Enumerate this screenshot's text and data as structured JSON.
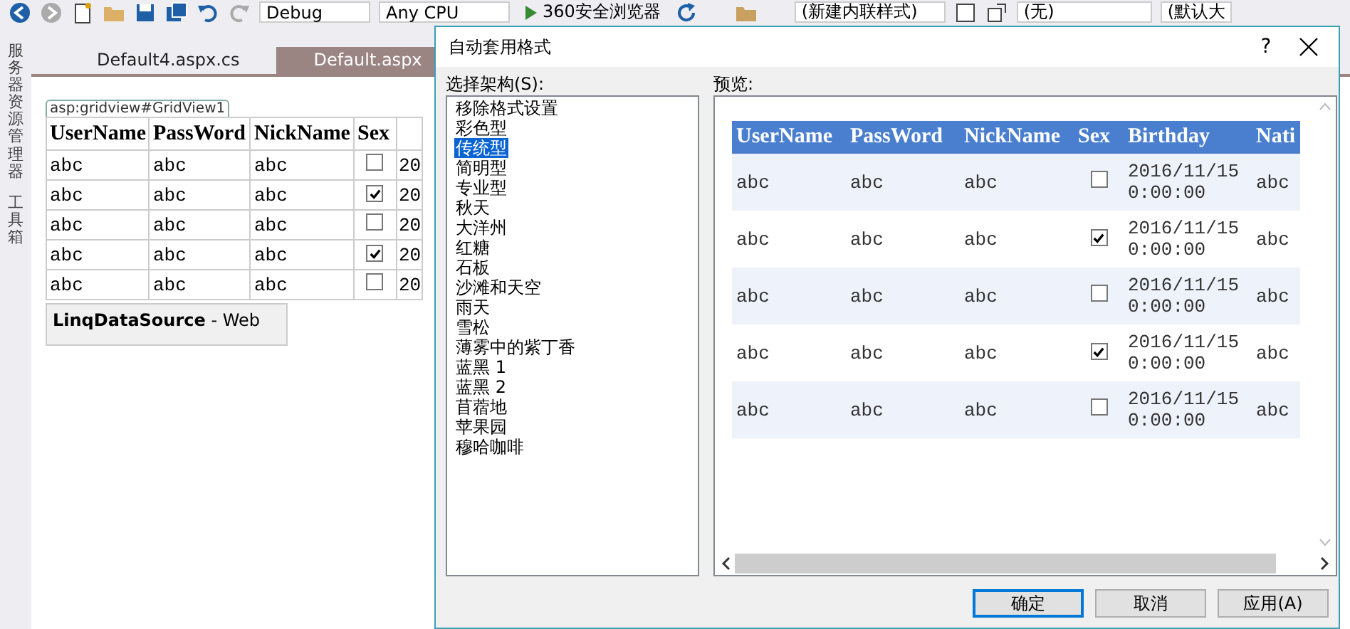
{
  "toolbar": {
    "configuration": "Debug",
    "platform": "Any CPU",
    "browser": "360安全浏览器",
    "style": "(新建内联样式)",
    "target": "(无)",
    "size": "(默认大"
  },
  "side_panels": [
    "服务器资源管理器",
    "工具箱"
  ],
  "tabs": [
    {
      "label": "Default4.aspx.cs",
      "selected": false
    },
    {
      "label": "Default.aspx",
      "selected": true
    }
  ],
  "designer": {
    "control_tag": "asp:gridview#GridView1",
    "grid": {
      "columns": [
        "UserName",
        "PassWord",
        "NickName",
        "Sex"
      ],
      "rows": [
        {
          "cells": [
            "abc",
            "abc",
            "abc"
          ],
          "checked": false,
          "column_5": "20"
        },
        {
          "cells": [
            "abc",
            "abc",
            "abc"
          ],
          "checked": true,
          "column_5": "20"
        },
        {
          "cells": [
            "abc",
            "abc",
            "abc"
          ],
          "checked": false,
          "column_5": "20"
        },
        {
          "cells": [
            "abc",
            "abc",
            "abc"
          ],
          "checked": true,
          "column_5": "20"
        },
        {
          "cells": [
            "abc",
            "abc",
            "abc"
          ],
          "checked": false,
          "column_5": "20"
        }
      ]
    },
    "data_source": "**LinqDataSource** - Web"
  },
  "dialog": {
    "title": "自动套用格式",
    "help": "?",
    "schemes_label": "选择架构(S):",
    "schemes": [
      {
        "label": "移除格式设置",
        "selected": false
      },
      {
        "label": "彩色型",
        "selected": false
      },
      {
        "label": "传统型",
        "selected": true
      },
      {
        "label": "简明型",
        "selected": false
      },
      {
        "label": "专业型",
        "selected": false
      },
      {
        "label": "秋天",
        "selected": false
      },
      {
        "label": "大洋州",
        "selected": false
      },
      {
        "label": "红糖",
        "selected": false
      },
      {
        "label": "石板",
        "selected": false
      },
      {
        "label": "沙滩和天空",
        "selected": false
      },
      {
        "label": "雨天",
        "selected": false
      },
      {
        "label": "雪松",
        "selected": false
      },
      {
        "label": "薄雾中的紫丁香",
        "selected": false
      },
      {
        "label": "蓝黑 1",
        "selected": false
      },
      {
        "label": "蓝黑 2",
        "selected": false
      },
      {
        "label": "苜蓿地",
        "selected": false
      },
      {
        "label": "苹果园",
        "selected": false
      },
      {
        "label": "穆哈咖啡",
        "selected": false
      }
    ],
    "preview_label": "预览:",
    "preview": {
      "columns": [
        "UserName",
        "PassWord",
        "NickName",
        "Sex",
        "Birthday",
        "Nati"
      ],
      "rows": [
        {
          "cells": [
            "abc",
            "abc",
            "abc"
          ],
          "checked": false,
          "birthday": "2016/11/15 0:00:00",
          "column_6": "abc"
        },
        {
          "cells": [
            "abc",
            "abc",
            "abc"
          ],
          "checked": true,
          "birthday": "2016/11/15 0:00:00",
          "column_6": "abc"
        },
        {
          "cells": [
            "abc",
            "abc",
            "abc"
          ],
          "checked": false,
          "birthday": "2016/11/15 0:00:00",
          "column_6": "abc"
        },
        {
          "cells": [
            "abc",
            "abc",
            "abc"
          ],
          "checked": true,
          "birthday": "2016/11/15 0:00:00",
          "column_6": "abc"
        },
        {
          "cells": [
            "abc",
            "abc",
            "abc"
          ],
          "checked": false,
          "birthday": "2016/11/15 0:00:00",
          "column_6": "abc"
        }
      ]
    },
    "buttons": [
      {
        "label": "确定",
        "default": true
      },
      {
        "label": "取消",
        "default": false
      },
      {
        "label": "应用(A)",
        "default": false
      }
    ]
  }
}
